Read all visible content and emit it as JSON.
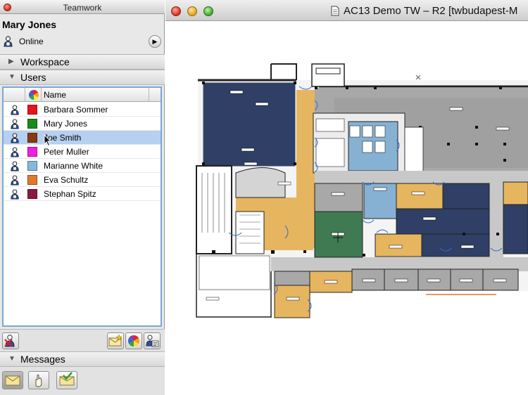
{
  "palette": {
    "title": "Teamwork",
    "user_name": "Mary Jones",
    "status": "Online",
    "sections": {
      "workspace": "Workspace",
      "users": "Users",
      "messages": "Messages"
    },
    "table": {
      "name_header": "Name"
    },
    "users": [
      {
        "name": "Barbara Sommer",
        "color": "#e8131b",
        "selected": false
      },
      {
        "name": "Mary Jones",
        "color": "#1a8a1a",
        "selected": false
      },
      {
        "name": "Joe Smith",
        "color": "#8b3a0e",
        "selected": true
      },
      {
        "name": "Peter Muller",
        "color": "#f01ee0",
        "selected": false
      },
      {
        "name": "Marianne White",
        "color": "#86b8dc",
        "selected": false
      },
      {
        "name": "Eva Schultz",
        "color": "#e07a2a",
        "selected": false
      },
      {
        "name": "Stephan Spitz",
        "color": "#8a1a3e",
        "selected": false
      }
    ]
  },
  "window": {
    "title": "AC13 Demo TW – R2  [twbudapest-M"
  },
  "floorplan": {
    "zone_colors": {
      "navy": "#2f3f66",
      "blue": "#4a6298",
      "grey": "#a8a8a8",
      "light_grey": "#d2d2d2",
      "tan": "#e6b55f",
      "sky": "#86b1d3",
      "green": "#3f7a52"
    }
  }
}
